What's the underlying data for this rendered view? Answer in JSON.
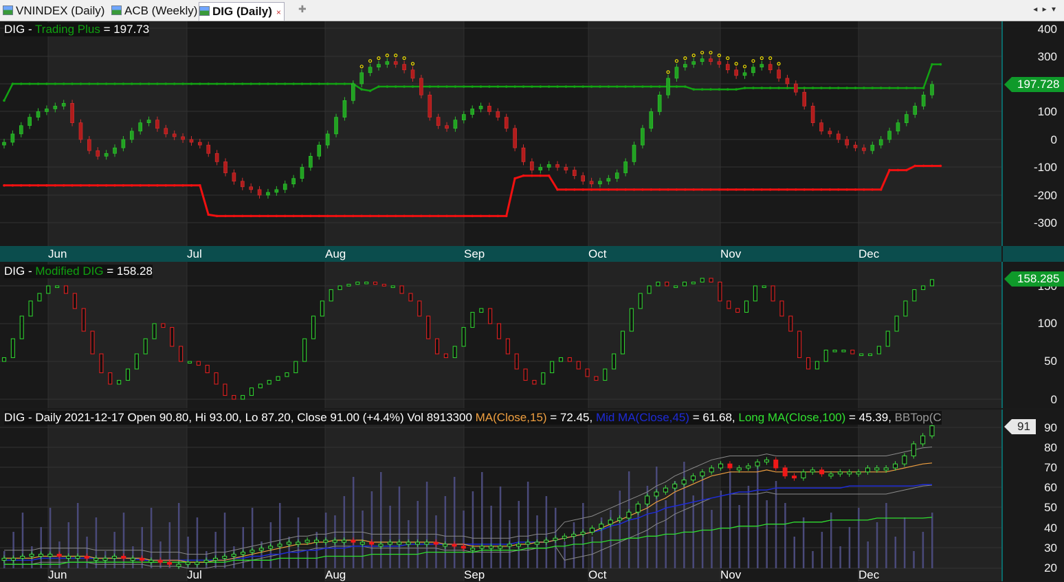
{
  "tabs": [
    {
      "label": "VNINDEX (Daily)",
      "active": false
    },
    {
      "label": "ACB (Weekly)",
      "active": false
    },
    {
      "label": "DIG (Daily)",
      "active": true
    }
  ],
  "tab_close": "×",
  "new_tab": "✚",
  "nav_arrows": "◂ ▸ ▾",
  "months": [
    "Jun",
    "Jul",
    "Aug",
    "Sep",
    "Oct",
    "Nov",
    "Dec"
  ],
  "pane1": {
    "prefix": "DIG - ",
    "indicator": "Trading Plus",
    "suffix": " = 197.73",
    "y_ticks": [
      "400",
      "300",
      "100",
      "0",
      "-100",
      "-200",
      "-300"
    ],
    "last_value": "197.728"
  },
  "pane2": {
    "prefix": "DIG - ",
    "indicator": "Modified DIG",
    "suffix": " = 158.28",
    "y_ticks": [
      "150",
      "100",
      "50",
      "0"
    ],
    "last_value": "158.285"
  },
  "pane3": {
    "info": "DIG - Daily 2021-12-17 Open 90.80, Hi 93.00, Lo 87.20, Close 91.00 (+4.4%) Vol 8913300 ",
    "ma_short": "MA(Close,15)",
    "ma_short_val": " = 72.45, ",
    "ma_mid": "Mid MA(Close,45)",
    "ma_mid_val": " = 61.68, ",
    "ma_long": "Long MA(Close,100)",
    "ma_long_val": " = 45.39, ",
    "bb": "BBTop(C",
    "y_ticks": [
      "90",
      "80",
      "70",
      "60",
      "50",
      "40",
      "30",
      "20"
    ],
    "last_value": "91"
  },
  "colors": {
    "up": "#1fa31f",
    "down": "#e01818",
    "accent": "#0f9a2a",
    "axis": "#0b6b6b"
  },
  "chart_data": [
    {
      "type": "line",
      "name": "Trading Plus",
      "x_labels": [
        "Jun",
        "Jul",
        "Aug",
        "Sep",
        "Oct",
        "Nov",
        "Dec"
      ],
      "ylim": [
        -400,
        400
      ],
      "values": [
        -10,
        20,
        50,
        80,
        100,
        110,
        120,
        130,
        60,
        0,
        -40,
        -60,
        -50,
        -30,
        0,
        30,
        60,
        70,
        40,
        20,
        10,
        0,
        -10,
        -20,
        -50,
        -80,
        -120,
        -150,
        -170,
        -180,
        -200,
        -190,
        -180,
        -160,
        -140,
        -100,
        -60,
        -20,
        20,
        80,
        140,
        200,
        240,
        260,
        270,
        280,
        270,
        250,
        220,
        160,
        80,
        50,
        40,
        70,
        90,
        110,
        120,
        100,
        80,
        40,
        -30,
        -80,
        -110,
        -100,
        -90,
        -100,
        -110,
        -130,
        -150,
        -160,
        -150,
        -140,
        -120,
        -80,
        -20,
        40,
        100,
        160,
        220,
        260,
        270,
        280,
        290,
        280,
        270,
        250,
        230,
        240,
        260,
        270,
        250,
        220,
        200,
        170,
        120,
        60,
        30,
        20,
        0,
        -20,
        -30,
        -40,
        -20,
        0,
        30,
        60,
        90,
        120,
        160,
        197.73
      ],
      "line_upper": [
        140,
        200,
        200,
        200,
        200,
        200,
        200,
        200,
        200,
        200,
        200,
        200,
        200,
        200,
        200,
        200,
        200,
        200,
        200,
        200,
        200,
        200,
        200,
        200,
        200,
        200,
        200,
        200,
        200,
        200,
        200,
        200,
        200,
        200,
        200,
        200,
        200,
        200,
        200,
        200,
        200,
        200,
        180,
        175,
        190,
        190,
        190,
        190,
        190,
        190,
        190,
        190,
        190,
        190,
        190,
        190,
        190,
        190,
        190,
        190,
        190,
        190,
        190,
        190,
        190,
        190,
        190,
        190,
        190,
        190,
        190,
        190,
        190,
        190,
        190,
        190,
        190,
        190,
        190,
        190,
        190,
        180,
        180,
        180,
        180,
        180,
        180,
        185,
        185,
        185,
        185,
        185,
        185,
        185,
        185,
        185,
        185,
        185,
        185,
        185,
        185,
        185,
        185,
        185,
        185,
        185,
        185,
        185,
        185,
        270,
        270
      ],
      "line_lower": [
        -165,
        -165,
        -165,
        -165,
        -165,
        -165,
        -165,
        -165,
        -165,
        -165,
        -165,
        -165,
        -165,
        -165,
        -165,
        -165,
        -165,
        -165,
        -165,
        -165,
        -165,
        -165,
        -165,
        -165,
        -270,
        -275,
        -275,
        -275,
        -275,
        -275,
        -275,
        -275,
        -275,
        -275,
        -275,
        -275,
        -275,
        -275,
        -275,
        -275,
        -275,
        -275,
        -275,
        -275,
        -275,
        -275,
        -275,
        -275,
        -275,
        -275,
        -275,
        -275,
        -275,
        -275,
        -275,
        -275,
        -275,
        -275,
        -275,
        -275,
        -140,
        -130,
        -130,
        -130,
        -130,
        -180,
        -180,
        -180,
        -180,
        -180,
        -180,
        -180,
        -180,
        -180,
        -180,
        -180,
        -180,
        -180,
        -180,
        -180,
        -180,
        -180,
        -180,
        -180,
        -180,
        -180,
        -180,
        -180,
        -180,
        -180,
        -180,
        -180,
        -180,
        -180,
        -180,
        -180,
        -180,
        -180,
        -180,
        -180,
        -180,
        -180,
        -180,
        -180,
        -110,
        -110,
        -110,
        -95,
        -95,
        -95,
        -95
      ]
    },
    {
      "type": "line",
      "name": "Modified DIG",
      "ylim": [
        -10,
        160
      ],
      "values": [
        55,
        80,
        110,
        130,
        140,
        150,
        150,
        140,
        120,
        90,
        60,
        35,
        20,
        25,
        40,
        60,
        80,
        100,
        95,
        70,
        50,
        50,
        45,
        35,
        20,
        5,
        0,
        5,
        15,
        20,
        25,
        30,
        35,
        50,
        80,
        110,
        130,
        145,
        150,
        152,
        155,
        155,
        152,
        150,
        150,
        140,
        130,
        110,
        80,
        60,
        55,
        70,
        95,
        115,
        120,
        100,
        80,
        60,
        40,
        25,
        20,
        35,
        50,
        55,
        50,
        40,
        30,
        25,
        40,
        60,
        90,
        120,
        140,
        150,
        155,
        150,
        150,
        155,
        155,
        160,
        155,
        130,
        120,
        115,
        130,
        150,
        150,
        130,
        110,
        90,
        55,
        40,
        50,
        65,
        65,
        65,
        60,
        60,
        60,
        70,
        90,
        110,
        130,
        145,
        150,
        158.28
      ]
    },
    {
      "type": "bar",
      "name": "DIG Daily",
      "ylim": [
        20,
        95
      ],
      "close": [
        25,
        25,
        26,
        27,
        27,
        27,
        26,
        26,
        26,
        25,
        25,
        25,
        26,
        25,
        25,
        24,
        24,
        23,
        22,
        22,
        23,
        23,
        24,
        25,
        26,
        27,
        28,
        29,
        30,
        31,
        32,
        33,
        33,
        34,
        34,
        34,
        34,
        34,
        33,
        33,
        32,
        32,
        33,
        33,
        33,
        33,
        33,
        32,
        32,
        31,
        30,
        30,
        31,
        31,
        31,
        32,
        32,
        33,
        33,
        34,
        35,
        36,
        37,
        38,
        40,
        42,
        44,
        45,
        48,
        52,
        56,
        58,
        60,
        62,
        64,
        66,
        68,
        70,
        72,
        70,
        70,
        71,
        73,
        74,
        70,
        66,
        65,
        68,
        69,
        67,
        67,
        68,
        68,
        68,
        70,
        70,
        70,
        72,
        76,
        82,
        86,
        91
      ],
      "ma_short": [
        25,
        25,
        25,
        25,
        26,
        26,
        26,
        26,
        26,
        26,
        25,
        25,
        25,
        25,
        25,
        25,
        24,
        24,
        24,
        24,
        23,
        23,
        23,
        24,
        24,
        25,
        26,
        27,
        28,
        29,
        30,
        31,
        32,
        32,
        33,
        33,
        34,
        34,
        34,
        34,
        33,
        33,
        33,
        33,
        33,
        33,
        33,
        33,
        32,
        32,
        32,
        31,
        31,
        31,
        31,
        31,
        32,
        32,
        33,
        33,
        34,
        35,
        36,
        37,
        38,
        40,
        42,
        44,
        46,
        48,
        50,
        53,
        55,
        58,
        60,
        62,
        64,
        66,
        67,
        68,
        68,
        68,
        68,
        69,
        68,
        68,
        68,
        68,
        68,
        68,
        68,
        68,
        68,
        68,
        68,
        68,
        68,
        69,
        70,
        71,
        72,
        72.45
      ],
      "ma_mid": [
        24,
        24,
        24,
        24,
        25,
        25,
        25,
        25,
        25,
        25,
        25,
        25,
        25,
        25,
        25,
        24,
        24,
        24,
        24,
        24,
        24,
        24,
        24,
        24,
        24,
        25,
        25,
        26,
        26,
        27,
        27,
        28,
        28,
        29,
        29,
        30,
        30,
        30,
        31,
        31,
        31,
        31,
        31,
        31,
        32,
        32,
        32,
        32,
        32,
        32,
        32,
        32,
        32,
        32,
        32,
        32,
        33,
        33,
        33,
        33,
        34,
        35,
        36,
        37,
        38,
        39,
        41,
        42,
        44,
        45,
        47,
        48,
        50,
        51,
        52,
        53,
        54,
        55,
        56,
        57,
        58,
        58,
        59,
        59,
        60,
        60,
        60,
        60,
        60,
        60,
        60,
        60,
        61,
        61,
        61,
        61,
        61,
        61,
        61,
        61,
        61.68,
        61.68
      ],
      "ma_long": [
        22,
        22,
        22,
        22,
        22,
        22,
        22,
        23,
        23,
        23,
        23,
        23,
        23,
        23,
        23,
        23,
        23,
        23,
        23,
        23,
        23,
        23,
        23,
        23,
        23,
        24,
        24,
        24,
        24,
        24,
        25,
        25,
        25,
        25,
        25,
        26,
        26,
        26,
        26,
        26,
        27,
        27,
        27,
        27,
        27,
        27,
        28,
        28,
        28,
        28,
        28,
        28,
        29,
        29,
        29,
        29,
        29,
        30,
        30,
        30,
        31,
        31,
        32,
        32,
        33,
        33,
        34,
        34,
        35,
        35,
        36,
        36,
        37,
        37,
        38,
        38,
        39,
        39,
        40,
        40,
        41,
        41,
        41,
        42,
        42,
        42,
        43,
        43,
        43,
        43,
        44,
        44,
        44,
        44,
        44,
        45,
        45,
        45,
        45,
        45,
        45,
        45.39
      ]
    }
  ]
}
